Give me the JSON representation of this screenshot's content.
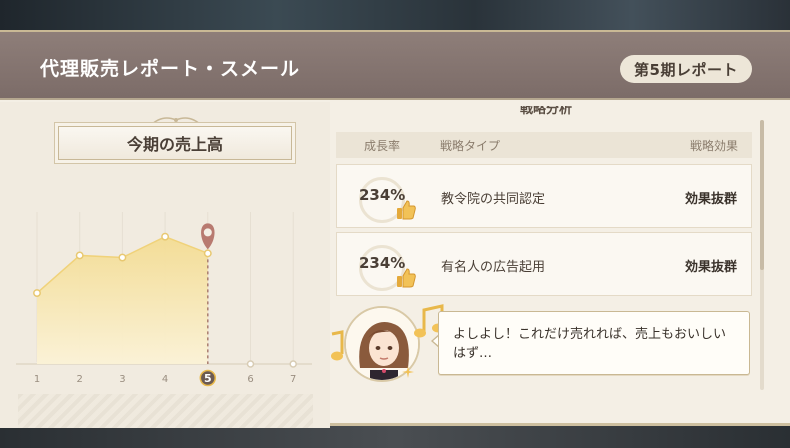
{
  "header": {
    "title": "代理販売レポート・スメール",
    "period_badge": "第5期レポート"
  },
  "chart_panel": {
    "title": "今期の売上高"
  },
  "chart_data": {
    "type": "area",
    "x": [
      1,
      2,
      3,
      4,
      5,
      6,
      7
    ],
    "values": [
      3.4,
      5.2,
      5.1,
      6.1,
      5.3,
      null,
      null
    ],
    "ylim": [
      0,
      8
    ],
    "current_period": 5,
    "grid": true,
    "color": "#f3dc93"
  },
  "analysis": {
    "section_title": "戦略分析",
    "columns": {
      "rate": "成長率",
      "type": "戦略タイプ",
      "effect": "戦略効果"
    },
    "rows": [
      {
        "rate": "234%",
        "strategy": "教令院の共同認定",
        "effect": "効果抜群"
      },
      {
        "rate": "234%",
        "strategy": "有名人の広告起用",
        "effect": "効果抜群"
      }
    ]
  },
  "dialogue": {
    "text": "よしよし！これだけ売れれば、売上もおいしいはず…"
  },
  "icons": {
    "thumb": "thumbs-up-icon",
    "pin": "map-pin-icon",
    "note": "music-note-icon"
  },
  "colors": {
    "header_bg": "#7f6f6b",
    "panel_bg": "#f4efe5",
    "area_fill": "#f3dc93",
    "pin": "#b87a70",
    "accent_gold": "#e8b84a"
  }
}
